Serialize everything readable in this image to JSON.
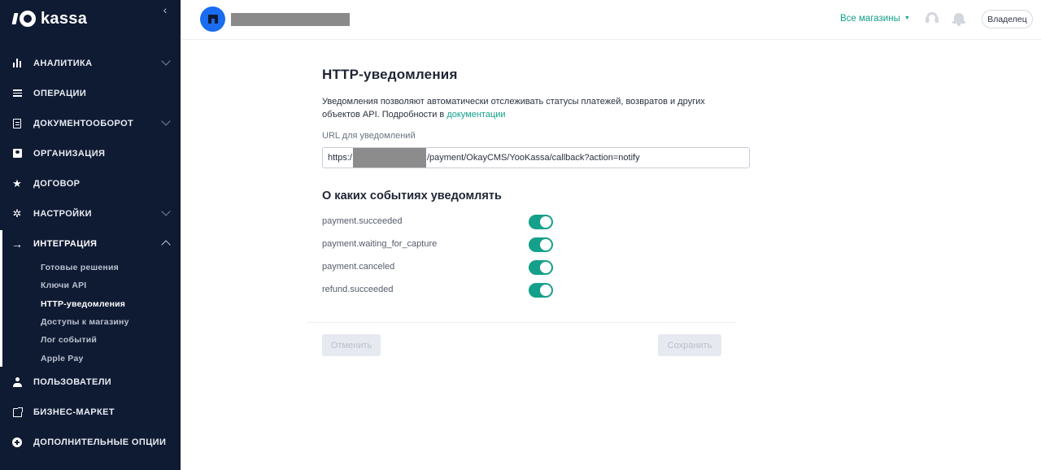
{
  "sidebar": {
    "logo_text": "kassa",
    "collapse_glyph": "‹",
    "items": [
      {
        "label": "АНАЛИТИКА",
        "icon": "bar-chart-icon",
        "has_chevron": true
      },
      {
        "label": "ОПЕРАЦИИ",
        "icon": "list-icon",
        "has_chevron": false
      },
      {
        "label": "ДОКУМЕНТООБОРОТ",
        "icon": "document-icon",
        "has_chevron": true
      },
      {
        "label": "ОРГАНИЗАЦИЯ",
        "icon": "id-card-icon",
        "has_chevron": false
      },
      {
        "label": "ДОГОВОР",
        "icon": "star-icon",
        "has_chevron": false
      },
      {
        "label": "НАСТРОЙКИ",
        "icon": "gear-icon",
        "has_chevron": true
      },
      {
        "label": "ИНТЕГРАЦИЯ",
        "icon": "arrow-right-icon",
        "has_chevron": true,
        "expanded": true
      },
      {
        "label": "ПОЛЬЗОВАТЕЛИ",
        "icon": "user-icon",
        "has_chevron": false
      },
      {
        "label": "БИЗНЕС-МАРКЕТ",
        "icon": "external-link-icon",
        "has_chevron": false
      },
      {
        "label": "ДОПОЛНИТЕЛЬНЫЕ ОПЦИИ",
        "icon": "plus-circle-icon",
        "has_chevron": false
      }
    ],
    "integration_sub": [
      {
        "label": "Готовые решения"
      },
      {
        "label": "Ключи API"
      },
      {
        "label": "HTTP-уведомления",
        "current": true
      },
      {
        "label": "Доступы к магазину"
      },
      {
        "label": "Лог событий"
      },
      {
        "label": "Apple Pay"
      }
    ]
  },
  "topbar": {
    "stores_label": "Все магазины",
    "stores_caret": "▼",
    "owner_label": "Владелец"
  },
  "main": {
    "title": "HTTP-уведомления",
    "description": "Уведомления позволяют автоматически отслеживать статусы платежей, возвратов и других объектов API. Подробности в ",
    "description_link": "документации",
    "url_label": "URL для уведомлений",
    "url_prefix": "https:/",
    "url_suffix": "/payment/OkayCMS/YooKassa/callback?action=notify",
    "events_title": "О каких событиях уведомлять",
    "events": [
      {
        "name": "payment.succeeded",
        "enabled": true
      },
      {
        "name": "payment.waiting_for_capture",
        "enabled": true
      },
      {
        "name": "payment.canceled",
        "enabled": true
      },
      {
        "name": "refund.succeeded",
        "enabled": true
      }
    ],
    "cancel_label": "Отменить",
    "save_label": "Сохранить"
  },
  "colors": {
    "sidebar_bg": "#0f1b33",
    "accent": "#14a08a",
    "avatar_blue": "#1a6cf0"
  }
}
